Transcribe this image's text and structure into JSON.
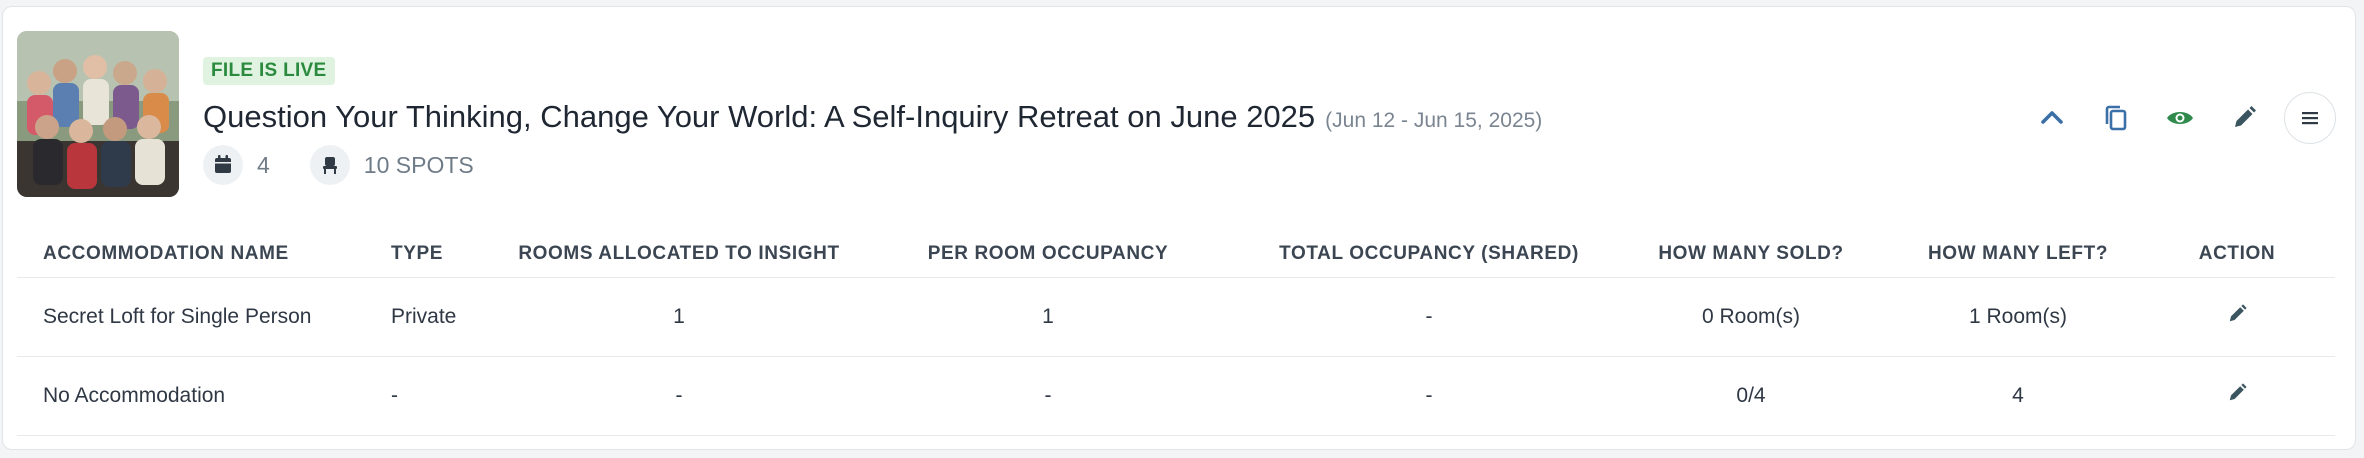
{
  "event": {
    "status_badge": "FILE IS LIVE",
    "title": "Question Your Thinking, Change Your World: A Self-Inquiry Retreat on June 2025",
    "dates": "(Jun 12 - Jun 15, 2025)",
    "days_count": "4",
    "spots": "10 SPOTS",
    "thumbnail_alt": "Group photo of retreat participants"
  },
  "actions": {
    "icons": [
      "chevron-up-icon",
      "copy-icon",
      "eye-icon",
      "pencil-icon",
      "menu-icon"
    ],
    "accent_color": "#3b6fa8",
    "view_color": "#2f8a4c",
    "edit_color": "#3a5560"
  },
  "table": {
    "headers": [
      "ACCOMMODATION NAME",
      "TYPE",
      "ROOMS ALLOCATED TO INSIGHT",
      "PER ROOM OCCUPANCY",
      "TOTAL OCCUPANCY (SHARED)",
      "HOW MANY SOLD?",
      "HOW MANY LEFT?",
      "ACTION"
    ],
    "rows": [
      {
        "name": "Secret Loft for Single Person",
        "type": "Private",
        "rooms_allocated": "1",
        "per_room_occupancy": "1",
        "total_occupancy": "-",
        "sold": "0 Room(s)",
        "left": "1 Room(s)"
      },
      {
        "name": "No Accommodation",
        "type": "-",
        "rooms_allocated": "-",
        "per_room_occupancy": "-",
        "total_occupancy": "-",
        "sold": "0/4",
        "left": "4"
      }
    ]
  }
}
